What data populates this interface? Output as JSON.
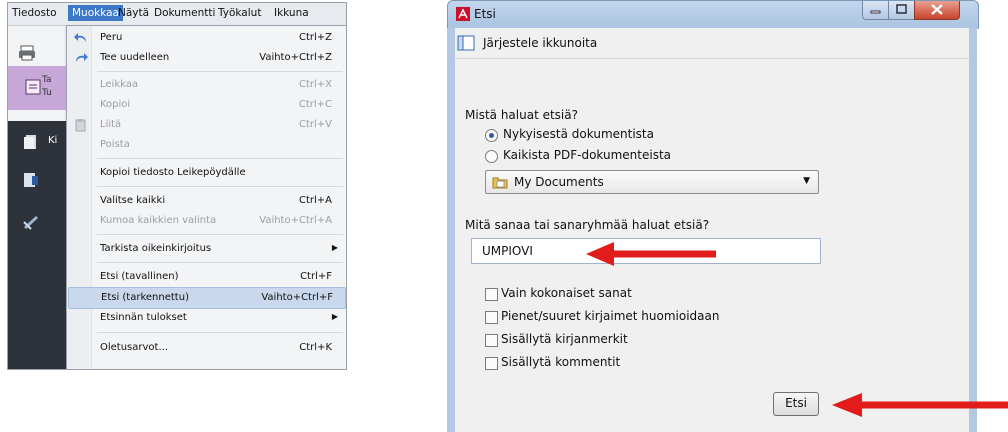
{
  "menubar": {
    "items": [
      "Tiedosto",
      "Muokkaa",
      "Näytä",
      "Dokumentti",
      "Työkalut",
      "Ikkuna"
    ],
    "active_index": 1
  },
  "app_side": {
    "purple_lines": [
      "Ta",
      "Tu"
    ],
    "tab_label": "Ki"
  },
  "edit_menu": {
    "items": [
      {
        "label": "Peru",
        "shortcut": "Ctrl+Z",
        "enabled": true,
        "icon": "undo-icon"
      },
      {
        "label": "Tee uudelleen",
        "shortcut": "Vaihto+Ctrl+Z",
        "enabled": true,
        "icon": "redo-icon"
      },
      {
        "label": "Leikkaa",
        "shortcut": "Ctrl+X",
        "enabled": false
      },
      {
        "label": "Kopioi",
        "shortcut": "Ctrl+C",
        "enabled": false
      },
      {
        "label": "Liitä",
        "shortcut": "Ctrl+V",
        "enabled": false,
        "icon": "paste-icon"
      },
      {
        "label": "Poista",
        "shortcut": "",
        "enabled": false
      },
      {
        "label": "Kopioi tiedosto Leikepöydälle",
        "shortcut": "",
        "enabled": true
      },
      {
        "label": "Valitse kaikki",
        "shortcut": "Ctrl+A",
        "enabled": true
      },
      {
        "label": "Kumoa kaikkien valinta",
        "shortcut": "Vaihto+Ctrl+A",
        "enabled": false
      },
      {
        "label": "Tarkista oikeinkirjoitus",
        "shortcut": "",
        "enabled": true,
        "submenu": true
      },
      {
        "label": "Etsi (tavallinen)",
        "shortcut": "Ctrl+F",
        "enabled": true
      },
      {
        "label": "Etsi (tarkennettu)",
        "shortcut": "Vaihto+Ctrl+F",
        "enabled": true,
        "selected": true
      },
      {
        "label": "Etsinnän tulokset",
        "shortcut": "",
        "enabled": true,
        "submenu": true
      },
      {
        "label": "Oletusarvot...",
        "shortcut": "Ctrl+K",
        "enabled": true
      }
    ]
  },
  "dialog": {
    "title": "Etsi",
    "arrange_label": "Järjestele ikkunoita",
    "where_question": "Mistä haluat etsiä?",
    "radio_current": "Nykyisestä dokumentista",
    "radio_all": "Kaikista PDF-dokumenteista",
    "folder_value": "My Documents",
    "what_question": "Mitä sanaa tai sanaryhmää haluat etsiä?",
    "search_value": "UMPIOVI",
    "checkboxes": [
      "Vain kokonaiset sanat",
      "Pienet/suuret kirjaimet huomioidaan",
      "Sisällytä kirjanmerkit",
      "Sisällytä kommentit"
    ],
    "search_button": "Etsi"
  },
  "colors": {
    "menu_highlight": "#c9d8ec",
    "menubar_active": "#3d79c7",
    "arrow": "#e21b1b",
    "titlebar": "#b3c8e3"
  }
}
